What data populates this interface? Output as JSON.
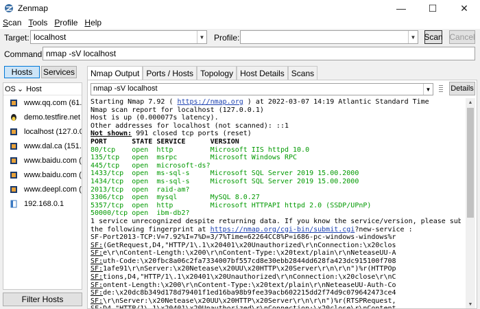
{
  "window": {
    "title": "Zenmap",
    "minimize": "—",
    "maximize": "☐",
    "close": "✕"
  },
  "menu": [
    {
      "u": "S",
      "rest": "can"
    },
    {
      "u": "T",
      "rest": "ools"
    },
    {
      "u": "P",
      "rest": "rofile"
    },
    {
      "u": "H",
      "rest": "elp"
    }
  ],
  "toolbar": {
    "target_label": "Target:",
    "target_value": "localhost",
    "profile_label": "Profile:",
    "profile_value": "",
    "scan_label": "Scan",
    "cancel_label": "Cancel",
    "command_label": "Command:",
    "command_value": "nmap -sV localhost"
  },
  "left": {
    "tabs": [
      "Hosts",
      "Services"
    ],
    "header_os": "OS",
    "header_sort": "⌄",
    "header_host": "Host",
    "hosts": [
      {
        "name": "www.qq.com (61.24",
        "os": "windows"
      },
      {
        "name": "demo.testfire.net (6",
        "os": "linux"
      },
      {
        "name": "localhost (127.0.0.1",
        "os": "windows"
      },
      {
        "name": "www.dal.ca (151.10",
        "os": "windows"
      },
      {
        "name": "www.baidu.com (14",
        "os": "windows"
      },
      {
        "name": "www.baidu.com (14",
        "os": "windows"
      },
      {
        "name": "www.deepl.com (17",
        "os": "windows"
      },
      {
        "name": "192.168.0.1",
        "os": "unknown"
      }
    ],
    "filter_label": "Filter Hosts"
  },
  "right": {
    "tabs": [
      "Nmap Output",
      "Ports / Hosts",
      "Topology",
      "Host Details",
      "Scans"
    ],
    "output_select": "nmap -sV localhost",
    "details_label": "Details",
    "lines": [
      "Starting Nmap 7.92 ( https://nmap.org ) at 2022-03-07 14:19 Atlantic Standard Time",
      "Nmap scan report for localhost (127.0.0.1)",
      "Host is up (0.000077s latency).",
      "Other addresses for localhost (not scanned): ::1",
      "Not shown: 991 closed tcp ports (reset)",
      "PORT      STATE SERVICE      VERSION",
      "80/tcp    open  http         Microsoft IIS httpd 10.0",
      "135/tcp   open  msrpc        Microsoft Windows RPC",
      "445/tcp   open  microsoft-ds?",
      "1433/tcp  open  ms-sql-s     Microsoft SQL Server 2019 15.00.2000",
      "1434/tcp  open  ms-sql-s     Microsoft SQL Server 2019 15.00.2000",
      "2013/tcp  open  raid-am?",
      "3306/tcp  open  mysql        MySQL 8.0.27",
      "5357/tcp  open  http         Microsoft HTTPAPI httpd 2.0 (SSDP/UPnP)",
      "50000/tcp open  ibm-db2?",
      "1 service unrecognized despite returning data. If you know the service/version, please submit",
      "the following fingerprint at https://nmap.org/cgi-bin/submit.cgi?new-service :",
      "SF-Port2013-TCP:V=7.92%I=7%D=3/7%Time=62264CC8%P=i686-pc-windows-windows%r",
      "SF:(GetRequest,D4,\"HTTP/1\\.1\\x20401\\x20Unauthorized\\r\\nConnection:\\x20clos",
      "SF:e\\r\\nContent-Length:\\x200\\r\\nContent-Type:\\x20text/plain\\r\\nNeteaseUU-A",
      "SF:uth-Code:\\x20fbc8a06c2fa7334007bf557cd8e30ebb2844dd628fa423dc915100f708",
      "SF:1afe91\\r\\nServer:\\x20Netease\\x20UU\\x20HTTP\\x20Server\\r\\n\\r\\n\")%r(HTTPOp",
      "SF:tions,D4,\"HTTP/1\\.1\\x20401\\x20Unauthorized\\r\\nConnection:\\x20close\\r\\nC",
      "SF:ontent-Length:\\x200\\r\\nContent-Type:\\x20text/plain\\r\\nNeteaseUU-Auth-Co",
      "SF:de:\\x20dc8b349d178d79401f1ed16ba98b9fee39acb602215dd2f74d9c079642473ce4",
      "SF:\\r\\nServer:\\x20Netease\\x20UU\\x20HTTP\\x20Server\\r\\n\\r\\n\")%r(RTSPRequest,",
      "SF:D4,\"HTTP/1\\.1\\x20401\\x20Unauthorized\\r\\nConnection:\\x20close\\r\\nContent"
    ]
  }
}
